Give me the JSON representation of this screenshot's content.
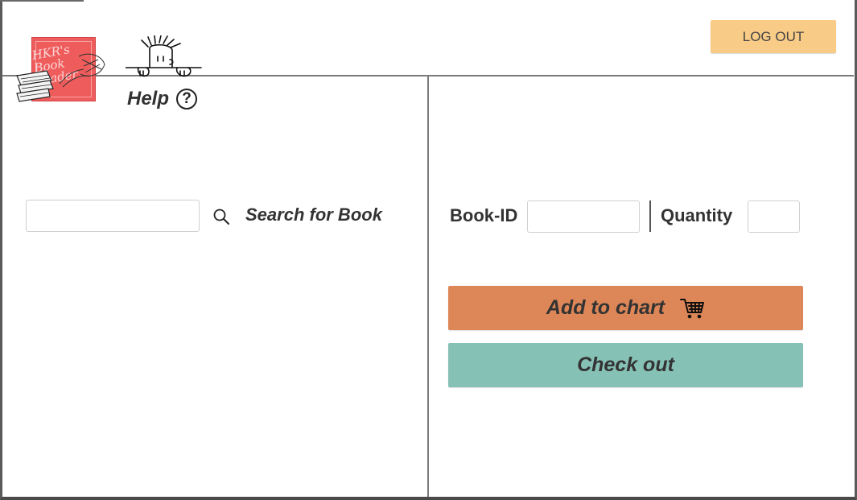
{
  "header": {
    "logo_text": "HKR's Book Trader",
    "logout_label": "LOG OUT"
  },
  "help": {
    "label": "Help",
    "icon": "question-circle-icon"
  },
  "search": {
    "value": "",
    "label": "Search for Book",
    "icon": "search-icon"
  },
  "order": {
    "book_id_label": "Book-ID",
    "book_id_value": "",
    "quantity_label": "Quantity",
    "quantity_value": "",
    "add_label": "Add to chart",
    "add_icon": "cart-icon",
    "checkout_label": "Check out"
  },
  "colors": {
    "logout": "#f8cb86",
    "add_to_chart": "#dd8657",
    "check_out": "#86c1b6",
    "logo": "#ef5c5c"
  }
}
